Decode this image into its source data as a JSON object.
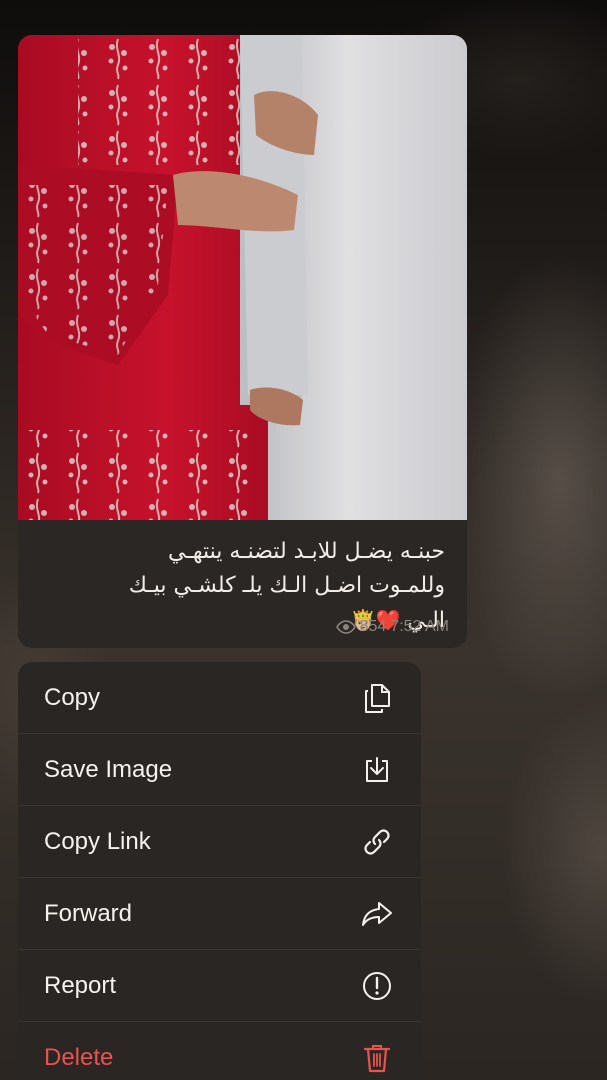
{
  "message": {
    "caption_lines": [
      "حبنـه يضـل للابـد لتضنـه ينتهـي",
      "وللمـوت اضـل الـك يلـ كلشـي بيـك",
      "الـي"
    ],
    "caption_emojis": "❤️🤴🏼",
    "views": "854",
    "time": "7:52 AM"
  },
  "menu": {
    "items": [
      {
        "label": "Copy",
        "icon": "copy-icon"
      },
      {
        "label": "Save Image",
        "icon": "save-image-icon"
      },
      {
        "label": "Copy Link",
        "icon": "link-icon"
      },
      {
        "label": "Forward",
        "icon": "forward-icon"
      },
      {
        "label": "Report",
        "icon": "report-icon"
      },
      {
        "label": "Delete",
        "icon": "trash-icon"
      }
    ]
  },
  "colors": {
    "bubble": "#2b2724",
    "menu": "#2a2623",
    "danger": "#e9534f",
    "dress_red": "#c8102e",
    "robe_white": "#e8e8ea"
  }
}
